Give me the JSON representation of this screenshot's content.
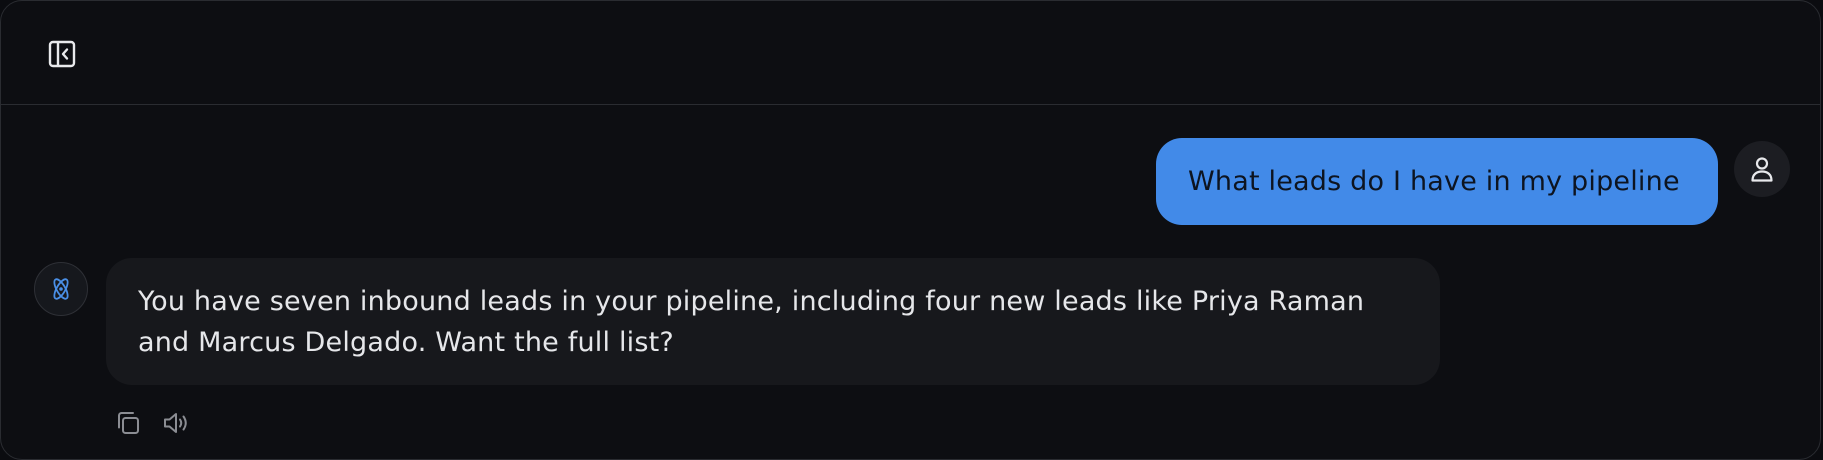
{
  "header": {
    "sidebar_toggle_icon": "sidebar-collapse-icon"
  },
  "conversation": {
    "messages": [
      {
        "role": "user",
        "text": "What leads do I have in my pipeline",
        "avatar_icon": "user-icon"
      },
      {
        "role": "assistant",
        "text": "You have seven inbound leads in your pipeline, including four new leads like Priya Raman and Marcus Delgado. Want the full list?",
        "avatar_icon": "atom-icon"
      }
    ],
    "message_actions": [
      {
        "icon": "copy-icon"
      },
      {
        "icon": "speaker-icon"
      }
    ]
  },
  "colors": {
    "background": "#0d0e12",
    "user_bubble": "#428ae8",
    "assistant_bubble": "#17181c",
    "accent_icon": "#4a8fe6"
  }
}
